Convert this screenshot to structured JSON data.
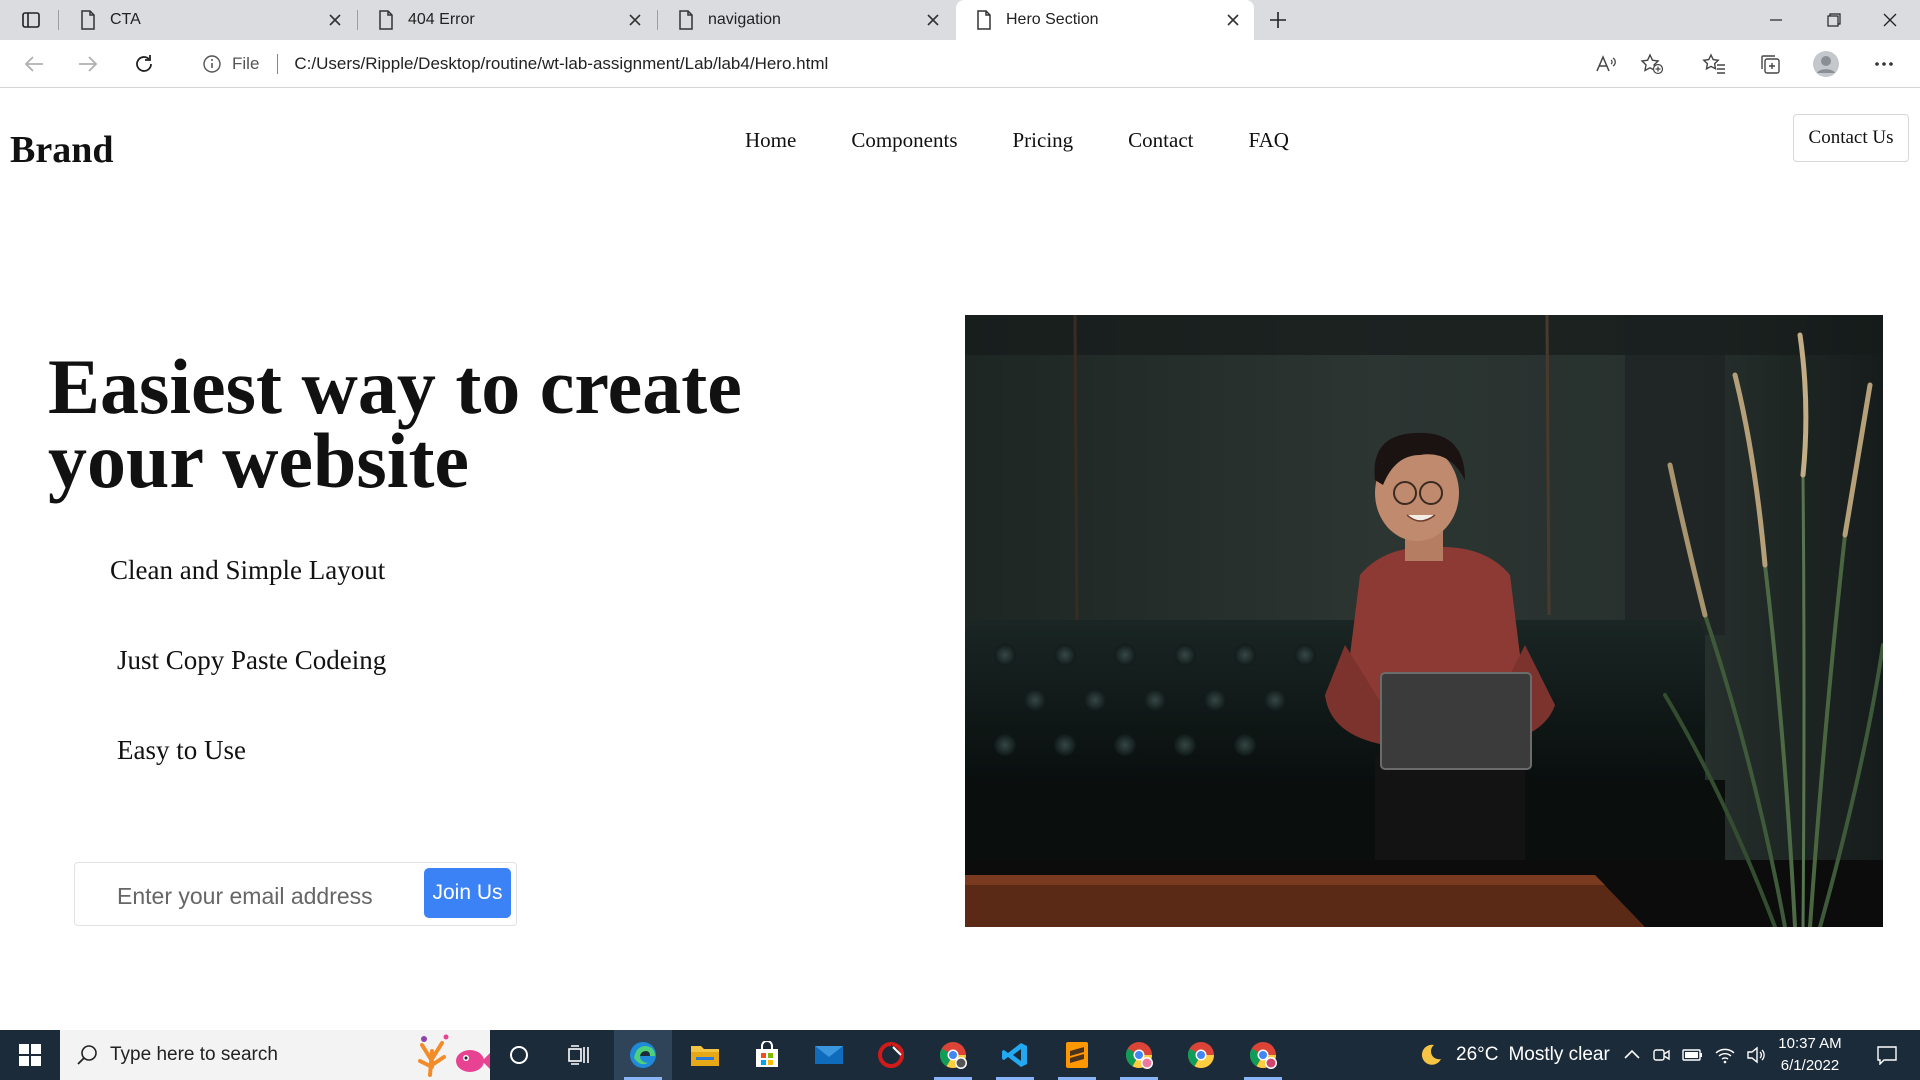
{
  "browser": {
    "tabs": [
      {
        "title": "CTA",
        "active": false
      },
      {
        "title": "404 Error",
        "active": false
      },
      {
        "title": "navigation",
        "active": false
      },
      {
        "title": "Hero Section",
        "active": true
      }
    ],
    "address": {
      "scheme_label": "File",
      "url": "C:/Users/Ripple/Desktop/routine/wt-lab-assignment/Lab/lab4/Hero.html"
    }
  },
  "page": {
    "brand": "Brand",
    "nav": [
      "Home",
      "Components",
      "Pricing",
      "Contact",
      "FAQ"
    ],
    "contact_button": "Contact Us",
    "hero": {
      "title": "Easiest way to create your website",
      "features": [
        "Clean and Simple Layout",
        "Just Copy Paste Codeing",
        "Easy to Use"
      ],
      "email_placeholder": "Enter your email address",
      "join_button": "Join Us"
    }
  },
  "taskbar": {
    "search_placeholder": "Type here to search",
    "weather": {
      "temp": "26°C",
      "condition": "Mostly clear"
    },
    "time": "10:37 AM",
    "date": "6/1/2022"
  },
  "colors": {
    "accent": "#3b82f6",
    "taskbar": "#1c2b3a",
    "tabbar": "#dadce0"
  }
}
